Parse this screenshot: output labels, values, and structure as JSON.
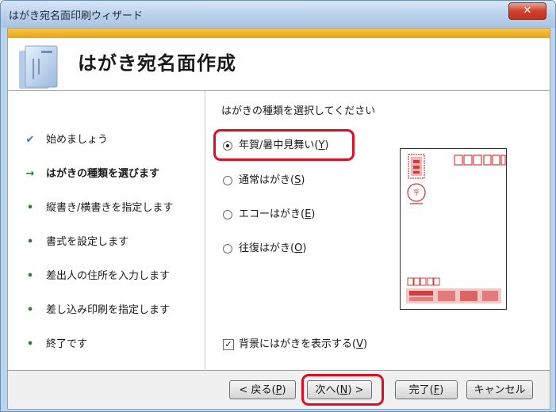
{
  "window": {
    "title": "はがき宛名面印刷ウィザード",
    "close_label": "✕"
  },
  "header": {
    "title": "はがき宛名面作成"
  },
  "steps": [
    {
      "label": "始めましょう",
      "marker": "check"
    },
    {
      "label": "はがきの種類を選びます",
      "marker": "arrow",
      "current": true
    },
    {
      "label": "縦書き/横書きを指定します",
      "marker": "bullet"
    },
    {
      "label": "書式を設定します",
      "marker": "bullet"
    },
    {
      "label": "差出人の住所を入力します",
      "marker": "bullet"
    },
    {
      "label": "差し込み印刷を指定します",
      "marker": "bullet"
    },
    {
      "label": "終了です",
      "marker": "bullet"
    }
  ],
  "panel": {
    "prompt": "はがきの種類を選択してください",
    "options": [
      {
        "label": "年賀/暑中見舞い(",
        "key": "Y",
        "end": ")",
        "selected": true
      },
      {
        "label": "通常はがき(",
        "key": "S",
        "end": ")",
        "selected": false
      },
      {
        "label": "エコーはがき(",
        "key": "E",
        "end": ")",
        "selected": false
      },
      {
        "label": "往復はがき(",
        "key": "O",
        "end": ")",
        "selected": false
      }
    ],
    "background_checkbox": {
      "label": "背景にはがきを表示する(",
      "key": "V",
      "end": ")",
      "checked": true
    }
  },
  "buttons": {
    "back": {
      "label": "< 戻る(",
      "key": "P",
      "end": ")"
    },
    "next": {
      "label": "次へ(",
      "key": "N",
      "end": ") >"
    },
    "finish": {
      "label": "完了(",
      "key": "F",
      "end": ")"
    },
    "cancel": {
      "label": "キャンセル"
    }
  },
  "colors": {
    "highlight_red": "#d90f24",
    "accent_orange": "#eba315",
    "stamp_red": "#d43b3b"
  },
  "icons": {
    "close": "close-icon",
    "wizard": "postcard-wizard-icon",
    "done": "check-icon",
    "current": "arrow-right-icon",
    "pending": "bullet-icon",
    "checkbox": "check-mark-icon"
  }
}
